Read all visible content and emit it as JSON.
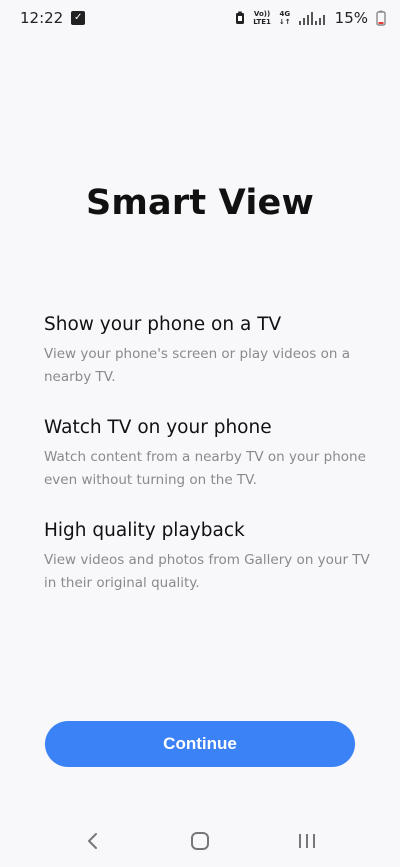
{
  "status_bar": {
    "time": "12:22",
    "notification_icon": "check-square-icon",
    "volte_label_top": "Vo))",
    "volte_label_bottom": "LTE1",
    "network_label": "4G",
    "signal_icon": "signal-bars-icon",
    "battery_percent": "15%",
    "battery_icon": "battery-icon"
  },
  "page": {
    "title": "Smart View",
    "features": [
      {
        "title": "Show your phone on a TV",
        "description": "View your phone's screen or play videos on a nearby TV."
      },
      {
        "title": "Watch TV on your phone",
        "description": "Watch content from a nearby TV on your phone even without turning on the TV."
      },
      {
        "title": "High quality playback",
        "description": "View videos and photos from Gallery on your TV in their original quality."
      }
    ],
    "continue_label": "Continue"
  },
  "navigation": {
    "back_icon": "back-chevron-icon",
    "home_icon": "home-icon",
    "recents_icon": "recents-icon"
  },
  "colors": {
    "background": "#f8f8fb",
    "button": "#3b82f6",
    "description": "#8a8a8a"
  }
}
